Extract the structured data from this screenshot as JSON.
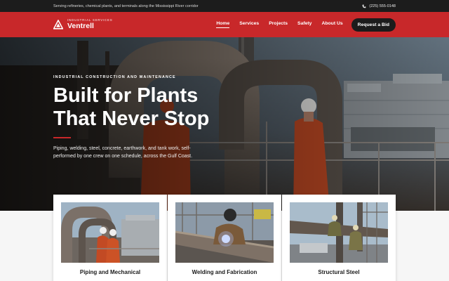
{
  "topbar": {
    "announcement": "Serving refineries, chemical plants, and terminals along the Mississippi River corridor",
    "phone": "(225) 555-0148",
    "phone_icon": "phone-icon"
  },
  "brand": {
    "tagline": "INDUSTRIAL SERVICES",
    "name": "Ventrell",
    "logo_icon": "triangle-logo-icon"
  },
  "nav": {
    "items": [
      {
        "label": "Home",
        "active": true
      },
      {
        "label": "Services",
        "active": false
      },
      {
        "label": "Projects",
        "active": false
      },
      {
        "label": "Safety",
        "active": false
      },
      {
        "label": "About Us",
        "active": false
      }
    ],
    "cta_label": "Request a Bid"
  },
  "hero": {
    "eyebrow": "INDUSTRIAL CONSTRUCTION AND MAINTENANCE",
    "headline": "Built for Plants That Never Stop",
    "subtext": "Piping, welding, steel, concrete, earthwork, and tank work, self-performed by one crew on one schedule, across the Gulf Coast."
  },
  "services": [
    {
      "title": "Piping and Mechanical"
    },
    {
      "title": "Welding and Fabrication"
    },
    {
      "title": "Structural Steel"
    }
  ],
  "colors": {
    "brand_red": "#c8282a",
    "dark": "#1c1c1c",
    "white": "#ffffff"
  }
}
